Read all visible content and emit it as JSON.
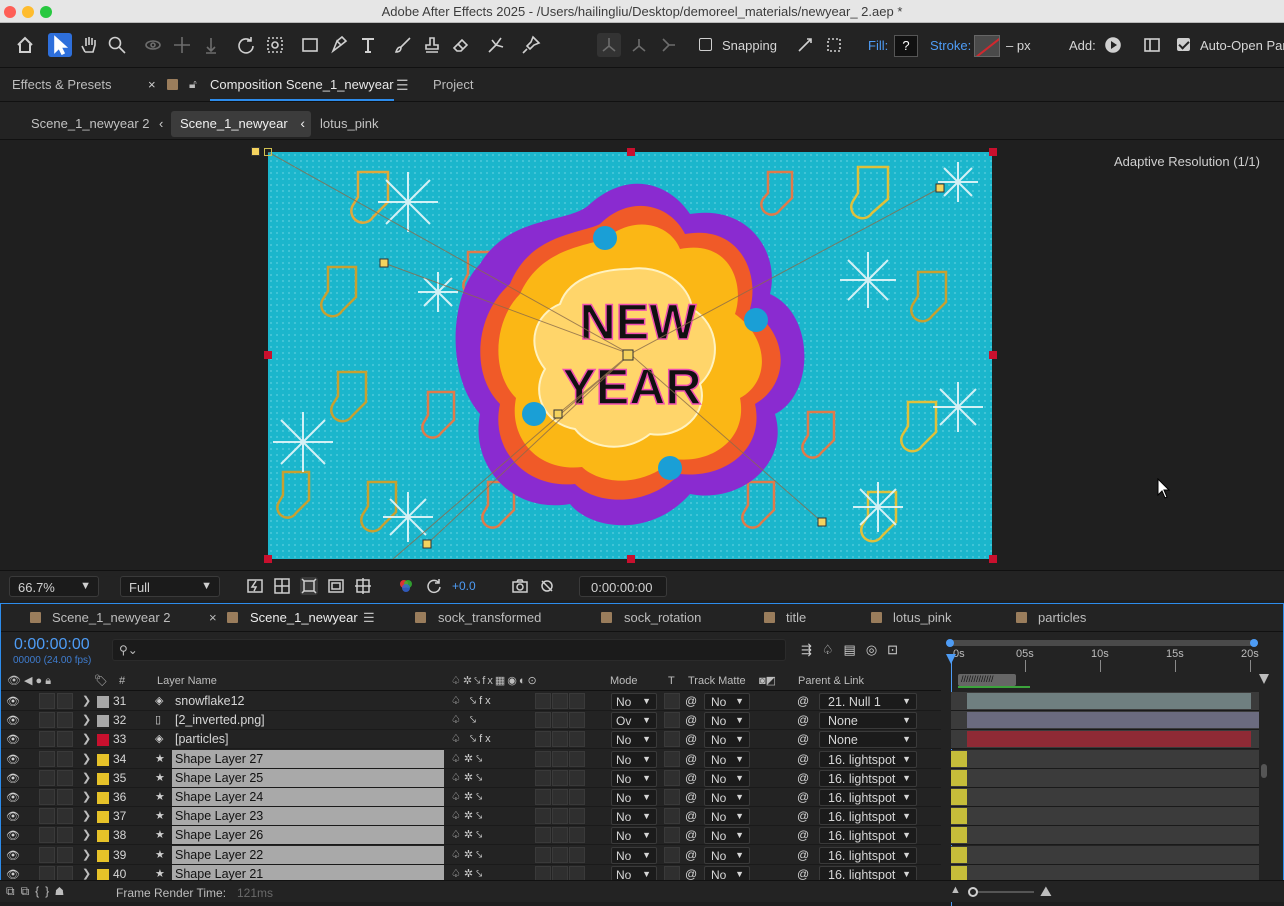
{
  "window": {
    "title": "Adobe After Effects 2025 - /Users/hailingliu/Desktop/demoreel_materials/newyear_ 2.aep *"
  },
  "toolbar": {
    "snapping_label": "Snapping",
    "fill_label": "Fill:",
    "fill_value": "?",
    "stroke_label": "Stroke:",
    "stroke_units": "– px",
    "add_label": "Add:",
    "auto_open_label": "Auto-Open Pan"
  },
  "panels": {
    "effects_tab": "Effects & Presets",
    "composition_tab": "Composition Scene_1_newyear",
    "project_tab": "Project"
  },
  "breadcrumbs": [
    "Scene_1_newyear 2",
    "Scene_1_newyear",
    "lotus_pink"
  ],
  "viewer": {
    "adaptive_resolution": "Adaptive Resolution (1/1)",
    "artwork_line1": "NEW",
    "artwork_line2": "YEAR",
    "zoom": "66.7%",
    "resolution": "Full",
    "exposure": "+0.0",
    "current_time": "0:00:00:00"
  },
  "timeline": {
    "tabs": [
      "Scene_1_newyear 2",
      "Scene_1_newyear",
      "sock_transformed",
      "sock_rotation",
      "title",
      "lotus_pink",
      "particles"
    ],
    "timecode": "0:00:00:00",
    "frames_fps": "00000 (24.00 fps)",
    "columns": {
      "number": "#",
      "layer_name": "Layer Name",
      "mode": "Mode",
      "t": "T",
      "track_matte": "Track Matte",
      "parent_link": "Parent & Link"
    },
    "ruler": [
      "0s",
      "05s",
      "10s",
      "15s",
      "20s"
    ],
    "layers": [
      {
        "num": "31",
        "name": "snowflake12",
        "mode": "No",
        "matte": "No",
        "parent": "21. Null 1",
        "color": "#a8a8a8",
        "kind": "precomp",
        "bar": "#6f7f80"
      },
      {
        "num": "32",
        "name": "[2_inverted.png]",
        "mode": "Ov",
        "matte": "No",
        "parent": "None",
        "color": "#a8a8a8",
        "kind": "footage",
        "bar": "#6b6b7f"
      },
      {
        "num": "33",
        "name": "[particles]",
        "mode": "No",
        "matte": "No",
        "parent": "None",
        "color": "#c8102e",
        "kind": "precomp",
        "bar": "#8f2a35"
      },
      {
        "num": "34",
        "name": "Shape Layer 27",
        "mode": "No",
        "matte": "No",
        "parent": "16. lightspot",
        "color": "#e6c229",
        "kind": "shape",
        "bar": "#c6bd3a"
      },
      {
        "num": "35",
        "name": "Shape Layer 25",
        "mode": "No",
        "matte": "No",
        "parent": "16. lightspot",
        "color": "#e6c229",
        "kind": "shape",
        "bar": "#c6bd3a"
      },
      {
        "num": "36",
        "name": "Shape Layer 24",
        "mode": "No",
        "matte": "No",
        "parent": "16. lightspot",
        "color": "#e6c229",
        "kind": "shape",
        "bar": "#c6bd3a"
      },
      {
        "num": "37",
        "name": "Shape Layer 23",
        "mode": "No",
        "matte": "No",
        "parent": "16. lightspot",
        "color": "#e6c229",
        "kind": "shape",
        "bar": "#c6bd3a"
      },
      {
        "num": "38",
        "name": "Shape Layer 26",
        "mode": "No",
        "matte": "No",
        "parent": "16. lightspot",
        "color": "#e6c229",
        "kind": "shape",
        "bar": "#c6bd3a"
      },
      {
        "num": "39",
        "name": "Shape Layer 22",
        "mode": "No",
        "matte": "No",
        "parent": "16. lightspot",
        "color": "#e6c229",
        "kind": "shape",
        "bar": "#c6bd3a"
      },
      {
        "num": "40",
        "name": "Shape Layer 21",
        "mode": "No",
        "matte": "No",
        "parent": "16. lightspot",
        "color": "#e6c229",
        "kind": "shape",
        "bar": "#c6bd3a"
      }
    ]
  },
  "status": {
    "frame_render_label": "Frame Render Time:",
    "frame_render_value": "121ms"
  }
}
